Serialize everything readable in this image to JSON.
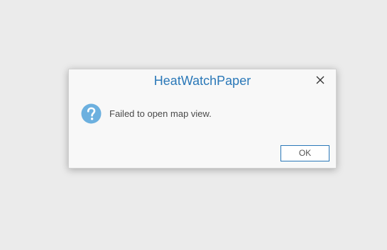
{
  "dialog": {
    "title": "HeatWatchPaper",
    "message": "Failed to open map view.",
    "message_icon": "question-icon",
    "close_icon": "close-icon",
    "ok_label": "OK"
  },
  "colors": {
    "background": "#ebebeb",
    "dialog_background": "#f8f8f8",
    "title": "#2a78b8",
    "icon": "#6cb0df",
    "button_border": "#2a78b8"
  }
}
